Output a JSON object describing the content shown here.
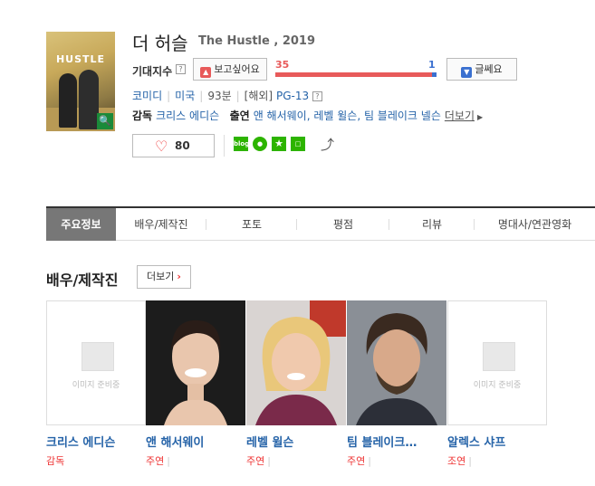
{
  "movie": {
    "title_kr": "더 허슬",
    "title_en": "The Hustle , 2019",
    "poster_title": "HUSTLE"
  },
  "expectation": {
    "label": "기대지수",
    "want_label": "보고싶어요",
    "want_count": "35",
    "no_label": "글쎄요",
    "no_count": "1",
    "want_ratio": 0.97
  },
  "meta": {
    "genre": "코미디",
    "country": "미국",
    "runtime": "93분",
    "rating_prefix": "[해외]",
    "rating": "PG-13"
  },
  "crew": {
    "director_label": "감독",
    "director": "크리스 에디슨",
    "cast_label": "출연",
    "cast": "앤 해서웨이, 레벨 윌슨, 팀 블레이크 넬슨",
    "more": "더보기"
  },
  "like": {
    "count": "80"
  },
  "share": {
    "blog": "blog"
  },
  "tabs": [
    "주요정보",
    "배우/제작진",
    "포토",
    "평점",
    "리뷰",
    "명대사/연관영화"
  ],
  "section": {
    "title": "배우/제작진",
    "more": "더보기"
  },
  "people": [
    {
      "name": "크리스 에디슨",
      "role": "감독",
      "photo": "none"
    },
    {
      "name": "앤 해서웨이",
      "role": "주연",
      "photo": "anne"
    },
    {
      "name": "레벨 윌슨",
      "role": "주연",
      "photo": "rebel"
    },
    {
      "name": "팀 블레이크…",
      "role": "주연",
      "photo": "tim"
    },
    {
      "name": "알렉스 샤프",
      "role": "조연",
      "photo": "none"
    }
  ],
  "noimage_label": "이미지 준비중"
}
